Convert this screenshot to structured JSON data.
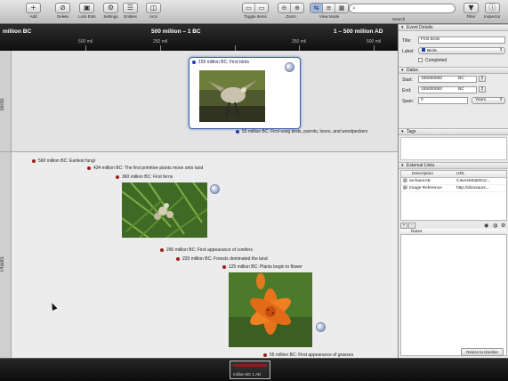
{
  "toolbar": {
    "add_label": "Add",
    "delete_label": "Delete",
    "lock_label": "Lock Evts",
    "settings_label": "Settings",
    "entities_label": "Entities",
    "arcs_label": "Arcs",
    "toggle_items_label": "Toggle Items",
    "zoom_label": "Zoom",
    "view_mode_label": "View Mode",
    "search_label": "Search",
    "filter_label": "Filter",
    "inspector_label": "Inspector"
  },
  "ruler": {
    "left_label": "million BC",
    "center_label": "500 million – 1 BC",
    "right_label": "1 – 500 million AD",
    "ticks": [
      "500 mil",
      "250 mil",
      "250 mil",
      "500 mil"
    ]
  },
  "lanes": {
    "birds_label": "Birds",
    "plants_label": "Plants"
  },
  "events": {
    "first_birds": "155 million BC: First birds",
    "song_birds": "55 million BC: First song birds, parrots, loons, and woodpeckers",
    "earliest_fungi": "560 million BC: Earliest fungi",
    "first_land_plants": "434 million BC: The first primitive plants move onto land",
    "first_ferns": "360 million BC: First ferns",
    "conifers": "290 million BC: First appearance of conifers",
    "forests": "220 million BC: Forests dominated the land",
    "flowers": "125 million BC: Plants begin to flower",
    "grasses": "55 million BC: First appearance of grasses"
  },
  "inspector": {
    "event_details_head": "Event Details",
    "title_label": "Title:",
    "title_value": "First birds",
    "label_label": "Label:",
    "label_value": "Birds",
    "completed_label": "Completed",
    "dates_head": "Dates",
    "start_label": "Start:",
    "start_value": "155000000",
    "start_era": "BC",
    "end_label": "End:",
    "end_value": "155000000",
    "end_era": "BC",
    "span_label": "Span:",
    "span_value": "0",
    "span_unit": "Years",
    "tags_head": "Tags",
    "links_head": "External Links",
    "col_description": "Description",
    "col_url": "URL",
    "links": [
      {
        "description": "archaeoAB",
        "url": "/Users/Matt/Doc..."
      },
      {
        "description": "Image Reference",
        "url": "http://dinosaurs..."
      }
    ],
    "add_symbol": "+",
    "remove_symbol": "−",
    "notes_head": "Notes"
  },
  "overview": {
    "window_label": "million BC  1 AD",
    "resize_label": "Resize to timeline"
  },
  "colors": {
    "plant_dot": "#9a1e1e",
    "bird_dot": "#1f3f9e",
    "selection": "#3d5fa8"
  }
}
